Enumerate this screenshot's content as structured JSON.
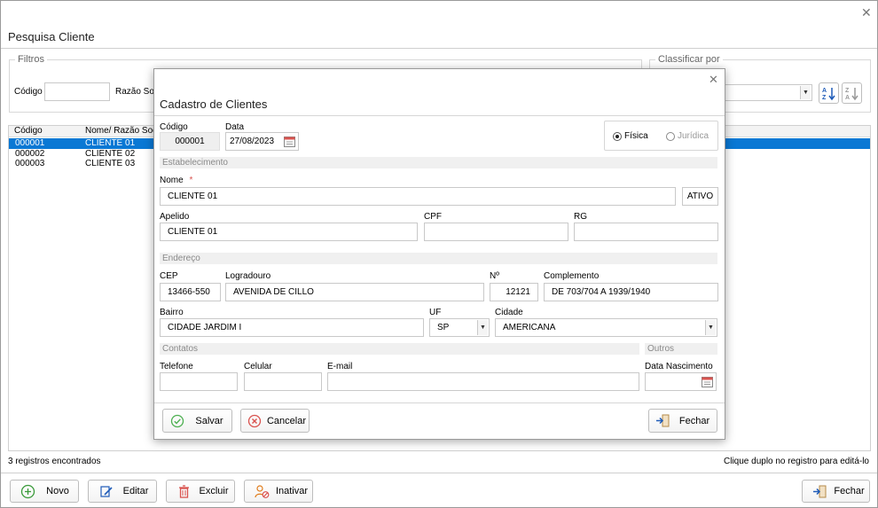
{
  "window": {
    "title": "Pesquisa Cliente",
    "close": "✕"
  },
  "filters": {
    "group_label": "Filtros",
    "codigo_label": "Código",
    "codigo_value": "",
    "razao_label": "Razão Socia"
  },
  "sort": {
    "group_label": "Classificar por",
    "value": ""
  },
  "grid": {
    "columns": [
      "Código",
      "Nome/ Razão Social"
    ],
    "rows": [
      {
        "codigo": "000001",
        "nome": "CLIENTE 01",
        "selected": true
      },
      {
        "codigo": "000002",
        "nome": "CLIENTE 02",
        "selected": false
      },
      {
        "codigo": "000003",
        "nome": "CLIENTE 03",
        "selected": false
      }
    ]
  },
  "status": {
    "count": "3 registros encontrados",
    "hint": "Clique duplo no registro para editá-lo"
  },
  "toolbar": {
    "novo": "Novo",
    "editar": "Editar",
    "excluir": "Excluir",
    "inativar": "Inativar",
    "fechar": "Fechar"
  },
  "modal": {
    "title": "Cadastro de Clientes",
    "close": "✕",
    "codigo_label": "Código",
    "codigo_value": "000001",
    "data_label": "Data",
    "data_value": "27/08/2023",
    "tipo_fisica": "Física",
    "tipo_juridica": "Jurídica",
    "section_estabelecimento": "Estabelecimento",
    "nome_label": "Nome",
    "required_mark": "*",
    "nome_value": "CLIENTE 01",
    "status_value": "ATIVO",
    "apelido_label": "Apelido",
    "apelido_value": "CLIENTE 01",
    "cpf_label": "CPF",
    "cpf_value": "",
    "rg_label": "RG",
    "rg_value": "",
    "section_endereco": "Endereço",
    "cep_label": "CEP",
    "cep_value": "13466-550",
    "logradouro_label": "Logradouro",
    "logradouro_value": "AVENIDA DE CILLO",
    "numero_label": "Nº",
    "numero_value": "12121",
    "complemento_label": "Complemento",
    "complemento_value": "DE 703/704 A 1939/1940",
    "bairro_label": "Bairro",
    "bairro_value": "CIDADE JARDIM I",
    "uf_label": "UF",
    "uf_value": "SP",
    "cidade_label": "Cidade",
    "cidade_value": "AMERICANA",
    "section_contatos": "Contatos",
    "section_outros": "Outros",
    "telefone_label": "Telefone",
    "celular_label": "Celular",
    "email_label": "E-mail",
    "nascimento_label": "Data Nascimento",
    "salvar": "Salvar",
    "cancelar": "Cancelar",
    "fechar": "Fechar"
  },
  "colors": {
    "selection": "#0a78d4",
    "border": "#c9c9c9",
    "section_bg": "#f0f0f0",
    "accent_blue": "#1e5bb8",
    "cancel_red": "#d9534f",
    "save_green": "#4caf50"
  }
}
